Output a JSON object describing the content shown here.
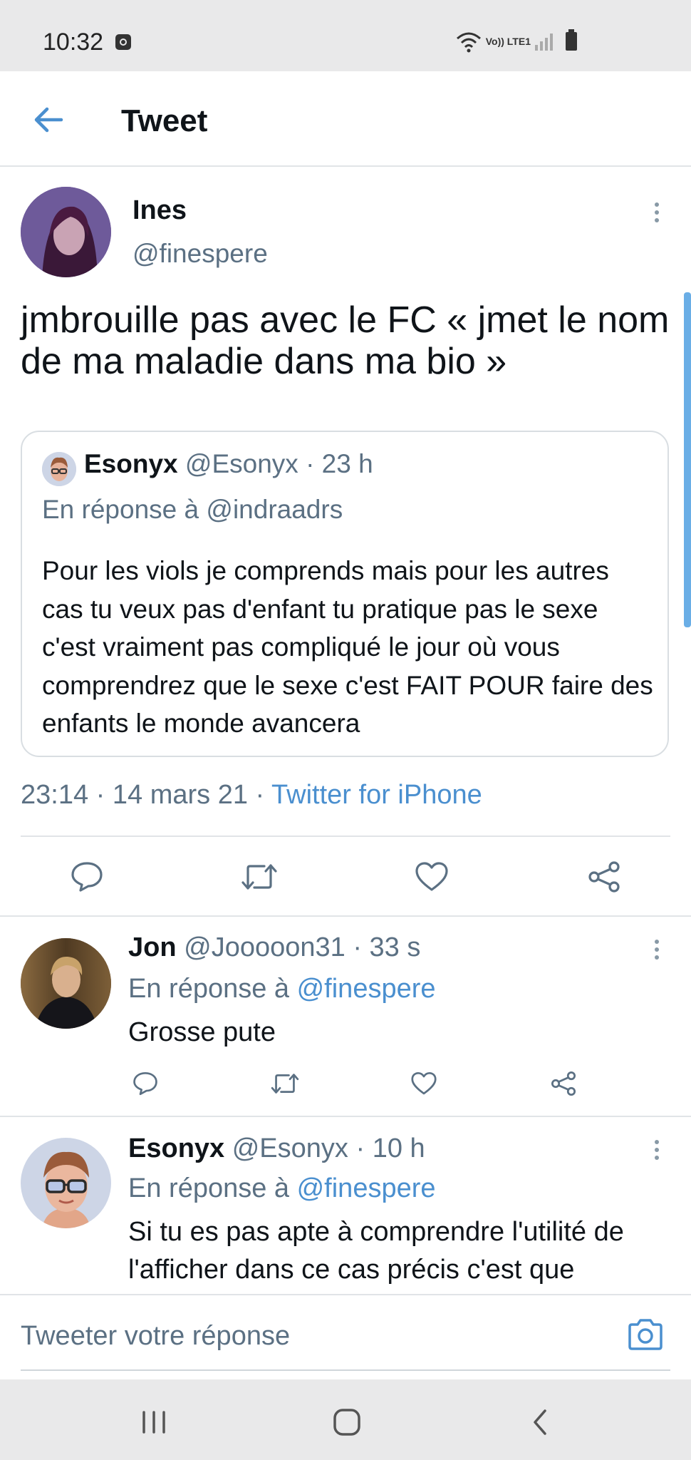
{
  "status_bar": {
    "time": "10:32",
    "network": "Vo)) LTE1"
  },
  "app_bar": {
    "title": "Tweet",
    "back_icon": "arrow-left-icon"
  },
  "tweet": {
    "author_name": "Ines",
    "author_handle": "@finespere",
    "text": "jmbrouille pas avec le FC « jmet le nom de ma maladie dans ma bio »",
    "quoted": {
      "author_name": "Esonyx",
      "author_handle": "@Esonyx · 23 h",
      "reply_to": "En réponse à @indraadrs",
      "text": "Pour les viols je comprends mais pour les autres cas tu veux pas d'enfant tu pratique pas le sexe c'est vraiment pas compliqué le jour où vous comprendrez que le sexe c'est FAIT POUR faire des enfants le monde avancera"
    },
    "timestamp": "23:14 · 14 mars 21 · ",
    "source": "Twitter for iPhone"
  },
  "replies": [
    {
      "author_name": "Jon",
      "author_handle": "@Jooooon31 · 33 s",
      "reply_prefix": "En réponse à ",
      "reply_mention": "@finespere",
      "text": "Grosse pute"
    },
    {
      "author_name": "Esonyx",
      "author_handle": "@Esonyx · 10 h",
      "reply_prefix": "En réponse à ",
      "reply_mention": "@finespere",
      "text": "Si tu es pas apte à comprendre l'utilité de l'afficher dans ce cas précis c'est que"
    }
  ],
  "composer": {
    "placeholder": "Tweeter votre réponse"
  },
  "colors": {
    "accent": "#4a8fcf",
    "secondary_text": "#5b7083",
    "divider": "#e1e4e7",
    "icon": "#5b7083"
  }
}
